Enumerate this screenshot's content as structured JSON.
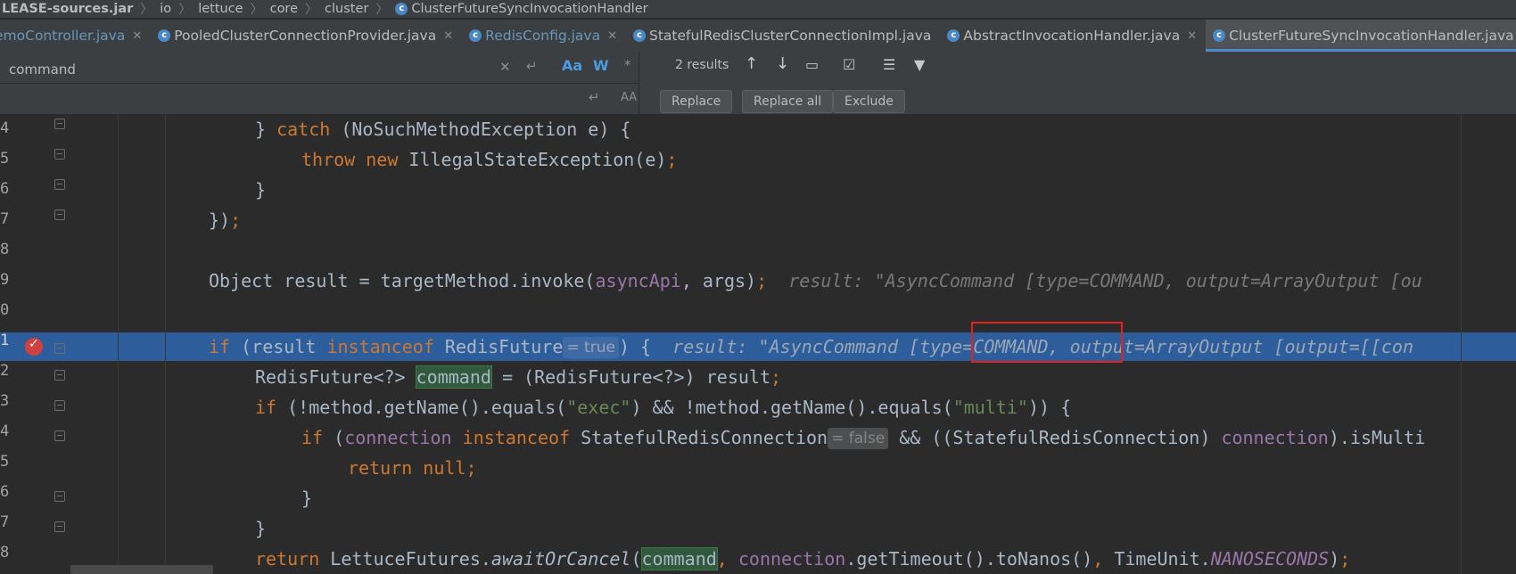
{
  "breadcrumb": [
    "LEASE-sources.jar",
    "io",
    "lettuce",
    "core",
    "cluster",
    "ClusterFutureSyncInvocationHandler"
  ],
  "tabs": [
    {
      "label": "emoController.java",
      "variant": "first"
    },
    {
      "label": "PooledClusterConnectionProvider.java",
      "variant": "normal"
    },
    {
      "label": "RedisConfig.java",
      "variant": "blue"
    },
    {
      "label": "StatefulRedisClusterConnectionImpl.java",
      "variant": "normal"
    },
    {
      "label": "AbstractInvocationHandler.java",
      "variant": "normal"
    },
    {
      "label": "ClusterFutureSyncInvocationHandler.java",
      "variant": "active"
    }
  ],
  "find": {
    "query": "command",
    "replace_value": "",
    "results": "2 results",
    "match_case_label": "Aa",
    "words_label": "W",
    "regex_label": "*",
    "preserve_case_label": "AA",
    "replace_button": "Replace",
    "replace_all_button": "Replace all",
    "exclude_button": "Exclude"
  },
  "editor": {
    "line_numbers": [
      "4",
      "5",
      "6",
      "7",
      "8",
      "9",
      "0",
      "1",
      "2",
      "3",
      "4",
      "5",
      "6",
      "7",
      "8"
    ],
    "inlays": {
      "instanceof_redis_future": "= true",
      "instanceof_stateful": "= false"
    },
    "debug_values": {
      "line9": "result: \"AsyncCommand [type=COMMAND, output=ArrayOutput [ou",
      "line11": "result: \"AsyncCommand [type=COMMAND, output=ArrayOutput [output=[[con"
    }
  },
  "colors": {
    "keyword": "#cc7832",
    "string": "#6a8759",
    "field": "#9876aa",
    "selection": "#2d5d9a",
    "highlight_box": "#e0231f"
  }
}
